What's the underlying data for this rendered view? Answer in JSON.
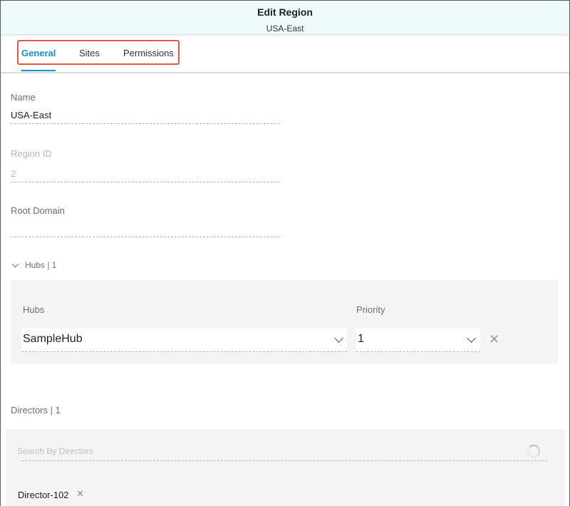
{
  "header": {
    "title": "Edit Region",
    "subtitle": "USA-East"
  },
  "tabs": [
    {
      "label": "General",
      "active": true
    },
    {
      "label": "Sites",
      "active": false
    },
    {
      "label": "Permissions",
      "active": false
    }
  ],
  "form": {
    "name": {
      "label": "Name",
      "value": "USA-East"
    },
    "region_id": {
      "label": "Region ID",
      "value": "2"
    },
    "root_domain": {
      "label": "Root Domain",
      "value": ""
    }
  },
  "hubs_section": {
    "toggle_label": "Hubs | 1",
    "hubs_label": "Hubs",
    "priority_label": "Priority",
    "rows": [
      {
        "hub": "SampleHub",
        "priority": "1"
      }
    ]
  },
  "directors_section": {
    "title": "Directors | 1",
    "search_placeholder": "Search By Directors",
    "chips": [
      "Director-102"
    ]
  },
  "colors": {
    "accent": "#1a8fd0",
    "highlight_box": "#e0584b",
    "header_bg": "#eefafc"
  }
}
